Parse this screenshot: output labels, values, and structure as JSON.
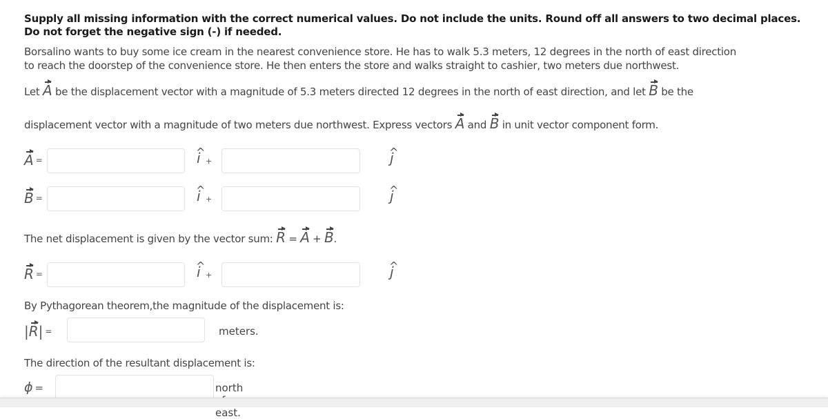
{
  "instructions": "Supply all missing information with the correct numerical values. Do not include the units. Round off all answers to two decimal places. Do not forget the negative sign (-) if needed.",
  "problem": {
    "line1": "Borsalino wants to buy some ice cream in the nearest convenience store. He has to walk 5.3 meters, 12 degrees in the north of east direction",
    "line2": "to reach the doorstep of the convenience store. He then enters the store and walks straight to cashier, two meters due northwest.",
    "let_prefix": "Let",
    "let_a_text": "be the displacement vector with a magnitude of 5.3 meters directed 12 degrees in the north of east direction, and let",
    "let_b_text": "be the",
    "line4_prefix": "displacement vector with a magnitude of two meters due northwest. Express vectors",
    "line4_and": "and",
    "line4_suffix": "in unit vector component form."
  },
  "symbols": {
    "A": "A",
    "B": "B",
    "R": "R",
    "equals": "=",
    "i_unit": "i",
    "j_unit": "j",
    "hat": "^",
    "plus": "+",
    "phi": "ϕ",
    "abs_bar": "|"
  },
  "vector_rows": [
    {
      "symbol": "A",
      "i_value": "",
      "j_value": ""
    },
    {
      "symbol": "B",
      "i_value": "",
      "j_value": ""
    }
  ],
  "net_displacement": {
    "text": "The net displacement is given by the vector sum:",
    "eq_sign": "=",
    "plus": "+",
    "period": "."
  },
  "resultant_row": {
    "symbol": "R",
    "i_value": "",
    "j_value": ""
  },
  "magnitude": {
    "text": "By Pythagorean theorem,the magnitude of the displacement is:",
    "value": "",
    "unit": "meters."
  },
  "direction": {
    "text": "The direction of the resultant displacement is:",
    "value": "",
    "suffix": "north of east."
  }
}
